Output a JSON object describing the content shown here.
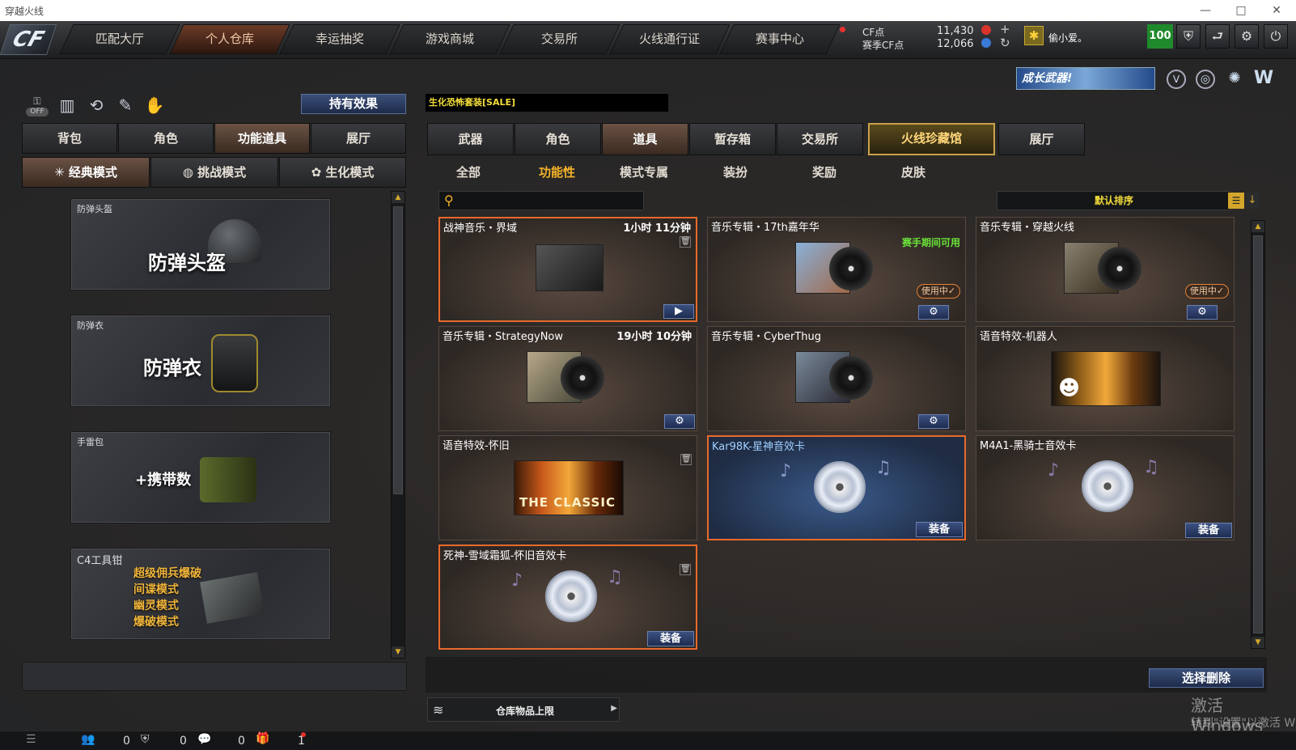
{
  "window": {
    "title": "穿越火线",
    "controls": [
      "—",
      "□",
      "✕"
    ]
  },
  "logo": "CF",
  "nav": {
    "tabs": [
      "匹配大厅",
      "个人仓库",
      "幸运抽奖",
      "游戏商城",
      "交易所",
      "火线通行证",
      "赛事中心"
    ],
    "active": 1
  },
  "currency": {
    "cf_label": "CF点",
    "cf_value": "11,430",
    "season_label": "赛季CF点",
    "season_value": "12,066"
  },
  "user": {
    "name": "偷小爱。",
    "level": "100"
  },
  "banner": {
    "text": "成长武器!"
  },
  "left": {
    "effects_button": "持有效果",
    "off_label": "OFF",
    "tabs": [
      "背包",
      "角色",
      "功能道具",
      "展厅"
    ],
    "active_tab": 2,
    "modes": [
      "经典模式",
      "挑战模式",
      "生化模式"
    ],
    "cards": [
      {
        "label": "防弹头盔",
        "big": "防弹头盔"
      },
      {
        "label": "防弹衣",
        "big": "防弹衣"
      },
      {
        "label": "手雷包",
        "big": "+携带数"
      },
      {
        "label": "C4工具钳",
        "lines": [
          "超级佣兵爆破",
          "间谍模式",
          "幽灵模式",
          "爆破模式"
        ]
      }
    ]
  },
  "right": {
    "notice": "生化恐怖套装[SALE]",
    "tabs": [
      "武器",
      "角色",
      "道具",
      "暂存箱",
      "交易所",
      "火线珍藏馆",
      "展厅"
    ],
    "active_tab": 2,
    "subtabs": [
      "全部",
      "功能性",
      "模式专属",
      "装扮",
      "奖励",
      "皮肤"
    ],
    "active_subtab": 1,
    "search": {
      "placeholder": ""
    },
    "sort_label": "默认排序",
    "items": [
      {
        "name": "战神音乐・界域",
        "time": "1小时 11分钟",
        "trash": "🗑",
        "play": "▶"
      },
      {
        "name": "音乐专辑・17th嘉年华",
        "season": "赛手期间可用",
        "inuse": "使用中✓",
        "gear": "⚙"
      },
      {
        "name": "音乐专辑・穿越火线",
        "inuse": "使用中✓",
        "gear": "⚙"
      },
      {
        "name": "音乐专辑・StrategyNow",
        "time": "19小时 10分钟",
        "gear": "⚙"
      },
      {
        "name": "音乐专辑・CyberThug",
        "gear": "⚙"
      },
      {
        "name": "语音特效-机器人"
      },
      {
        "name": "语音特效-怀旧",
        "trash": "🗑",
        "classic": "THE CLASSIC"
      },
      {
        "name": "Kar98K-星神音效卡",
        "equip": "装备"
      },
      {
        "name": "M4A1-黑骑士音效卡",
        "equip": "装备"
      },
      {
        "name": "死神-雪域霜狐-怀旧音效卡",
        "trash": "🗑",
        "equip": "装备"
      }
    ],
    "delete_button": "选择删除",
    "capacity_label": "仓库物品上限"
  },
  "status": {
    "counts": [
      "0",
      "0",
      "0",
      "1"
    ]
  },
  "watermark": {
    "line1": "激活 Windows",
    "line2": "转到\"设置\"以激活 W"
  }
}
